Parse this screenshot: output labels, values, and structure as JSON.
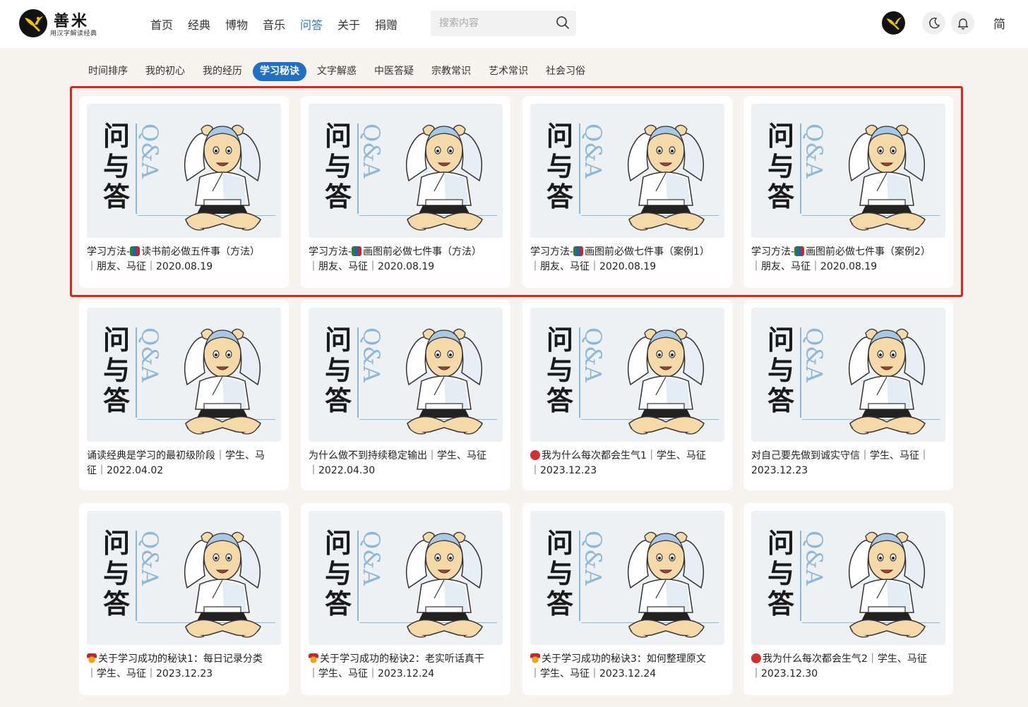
{
  "header": {
    "logo_name": "善米",
    "logo_sub": "用汉字解读经典",
    "nav": [
      "首页",
      "经典",
      "博物",
      "音乐",
      "问答",
      "关于",
      "捐赠"
    ],
    "nav_active": "问答",
    "search_placeholder": "搜索内容",
    "lang_label": "简"
  },
  "tabs": [
    "时间排序",
    "我的初心",
    "我的经历",
    "学习秘诀",
    "文字解惑",
    "中医答疑",
    "宗教常识",
    "艺术常识",
    "社会习俗"
  ],
  "active_tab": "学习秘诀",
  "thumbnail": {
    "title_chars": [
      "问",
      "与",
      "答"
    ],
    "qa_text": "Q&A"
  },
  "cards": [
    {
      "title": "学习方法-",
      "emoji": "books",
      "rest": "读书前必做五件事（方法）",
      "meta": "｜朋友、马征｜2020.08.19"
    },
    {
      "title": "学习方法-",
      "emoji": "books",
      "rest": "画图前必做七件事（方法）",
      "meta": "｜朋友、马征｜2020.08.19"
    },
    {
      "title": "学习方法-",
      "emoji": "books",
      "rest": "画图前必做七件事（案例1）",
      "meta": "｜朋友、马征｜2020.08.19"
    },
    {
      "title": "学习方法-",
      "emoji": "books",
      "rest": "画图前必做七件事（案例2）",
      "meta": "｜朋友、马征｜2020.08.19"
    },
    {
      "title": "",
      "emoji": "",
      "rest": "诵读经典是学习的最初级阶段｜学生、马",
      "meta": "征｜2022.04.02"
    },
    {
      "title": "",
      "emoji": "",
      "rest": "为什么做不到持续稳定输出｜学生、马征",
      "meta": "｜2022.04.30"
    },
    {
      "title": "",
      "emoji": "angry",
      "rest": "我为什么每次都会生气1｜学生、马征",
      "meta": "｜2023.12.23"
    },
    {
      "title": "",
      "emoji": "",
      "rest": "对自己要先做到诚实守信｜学生、马征｜",
      "meta": "2023.12.23"
    },
    {
      "title": "",
      "emoji": "medal",
      "rest": "关于学习成功的秘诀1：每日记录分类",
      "meta": "｜学生、马征｜2023.12.23"
    },
    {
      "title": "",
      "emoji": "medal",
      "rest": "关于学习成功的秘诀2：老实听话真干",
      "meta": "｜学生、马征｜2023.12.24"
    },
    {
      "title": "",
      "emoji": "medal",
      "rest": "关于学习成功的秘诀3：如何整理原文",
      "meta": "｜学生、马征｜2023.12.24"
    },
    {
      "title": "",
      "emoji": "angry",
      "rest": "我为什么每次都会生气2｜学生、马征",
      "meta": "｜2023.12.30"
    }
  ],
  "colors": {
    "accent": "#1f6fc5",
    "highlight_border": "#e0261c",
    "qa_blue": "#8fb8d6"
  }
}
